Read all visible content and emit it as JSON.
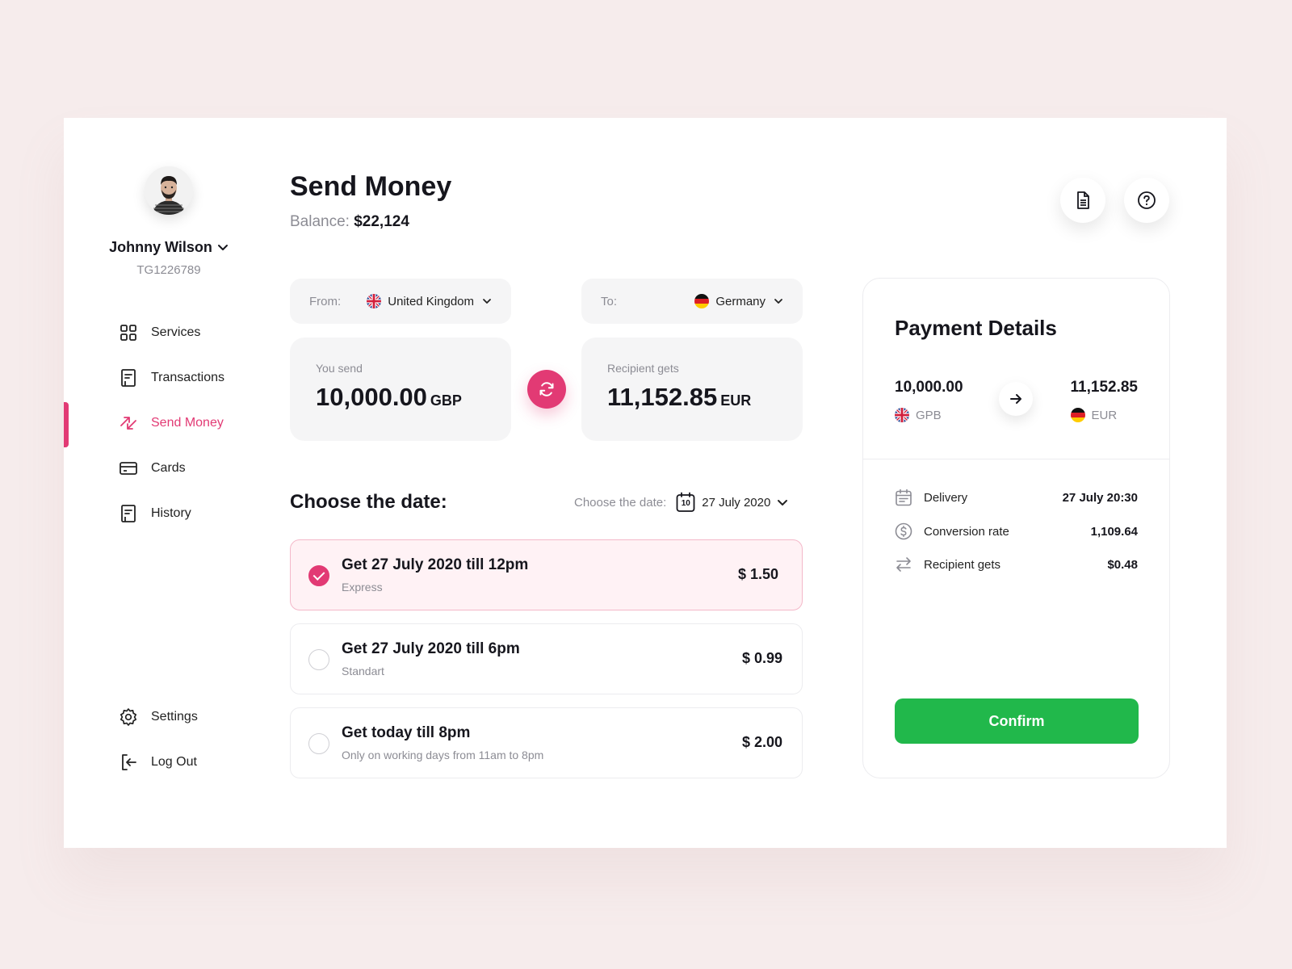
{
  "user": {
    "name": "Johnny Wilson",
    "id": "TG1226789"
  },
  "nav": {
    "items": [
      {
        "label": "Services",
        "icon": "grid-icon"
      },
      {
        "label": "Transactions",
        "icon": "receipt-icon"
      },
      {
        "label": "Send Money",
        "icon": "transfer-arrows-icon",
        "active": true
      },
      {
        "label": "Cards",
        "icon": "card-icon"
      },
      {
        "label": "History",
        "icon": "receipt-icon"
      }
    ],
    "bottom": [
      {
        "label": "Settings",
        "icon": "gear-icon"
      },
      {
        "label": "Log Out",
        "icon": "logout-icon"
      }
    ]
  },
  "header": {
    "title": "Send Money",
    "balance_label": "Balance:",
    "balance_value": "$22,124"
  },
  "transfer": {
    "from_label": "From:",
    "from_country": "United Kingdom",
    "to_label": "To:",
    "to_country": "Germany",
    "send_label": "You send",
    "send_amount": "10,000.00",
    "send_currency": "GBP",
    "receive_label": "Recipient gets",
    "receive_amount": "11,152.85",
    "receive_currency": "EUR"
  },
  "date": {
    "title": "Choose the date:",
    "picker_label": "Choose the date:",
    "picker_day": "10",
    "picker_value": "27 July 2020"
  },
  "options": [
    {
      "title": "Get 27 July 2020 till 12pm",
      "subtitle": "Express",
      "price": "$ 1.50",
      "selected": true
    },
    {
      "title": "Get 27 July 2020 till 6pm",
      "subtitle": "Standart",
      "price": "$ 0.99",
      "selected": false
    },
    {
      "title": "Get today till 8pm",
      "subtitle": "Only on working days from 11am to 8pm",
      "price": "$ 2.00",
      "selected": false
    }
  ],
  "payment": {
    "title": "Payment Details",
    "from_amount": "10,000.00",
    "from_currency": "GPB",
    "to_amount": "11,152.85",
    "to_currency": "EUR",
    "rows": [
      {
        "label": "Delivery",
        "value": "27 July 20:30",
        "icon": "calendar-icon"
      },
      {
        "label": "Conversion rate",
        "value": "1,109.64",
        "icon": "dollar-coin-icon"
      },
      {
        "label": "Recipient gets",
        "value": "$0.48",
        "icon": "exchange-icon"
      }
    ],
    "confirm_label": "Confirm"
  },
  "colors": {
    "accent": "#e23a74",
    "confirm": "#21b84b",
    "background": "#f6ecec"
  }
}
